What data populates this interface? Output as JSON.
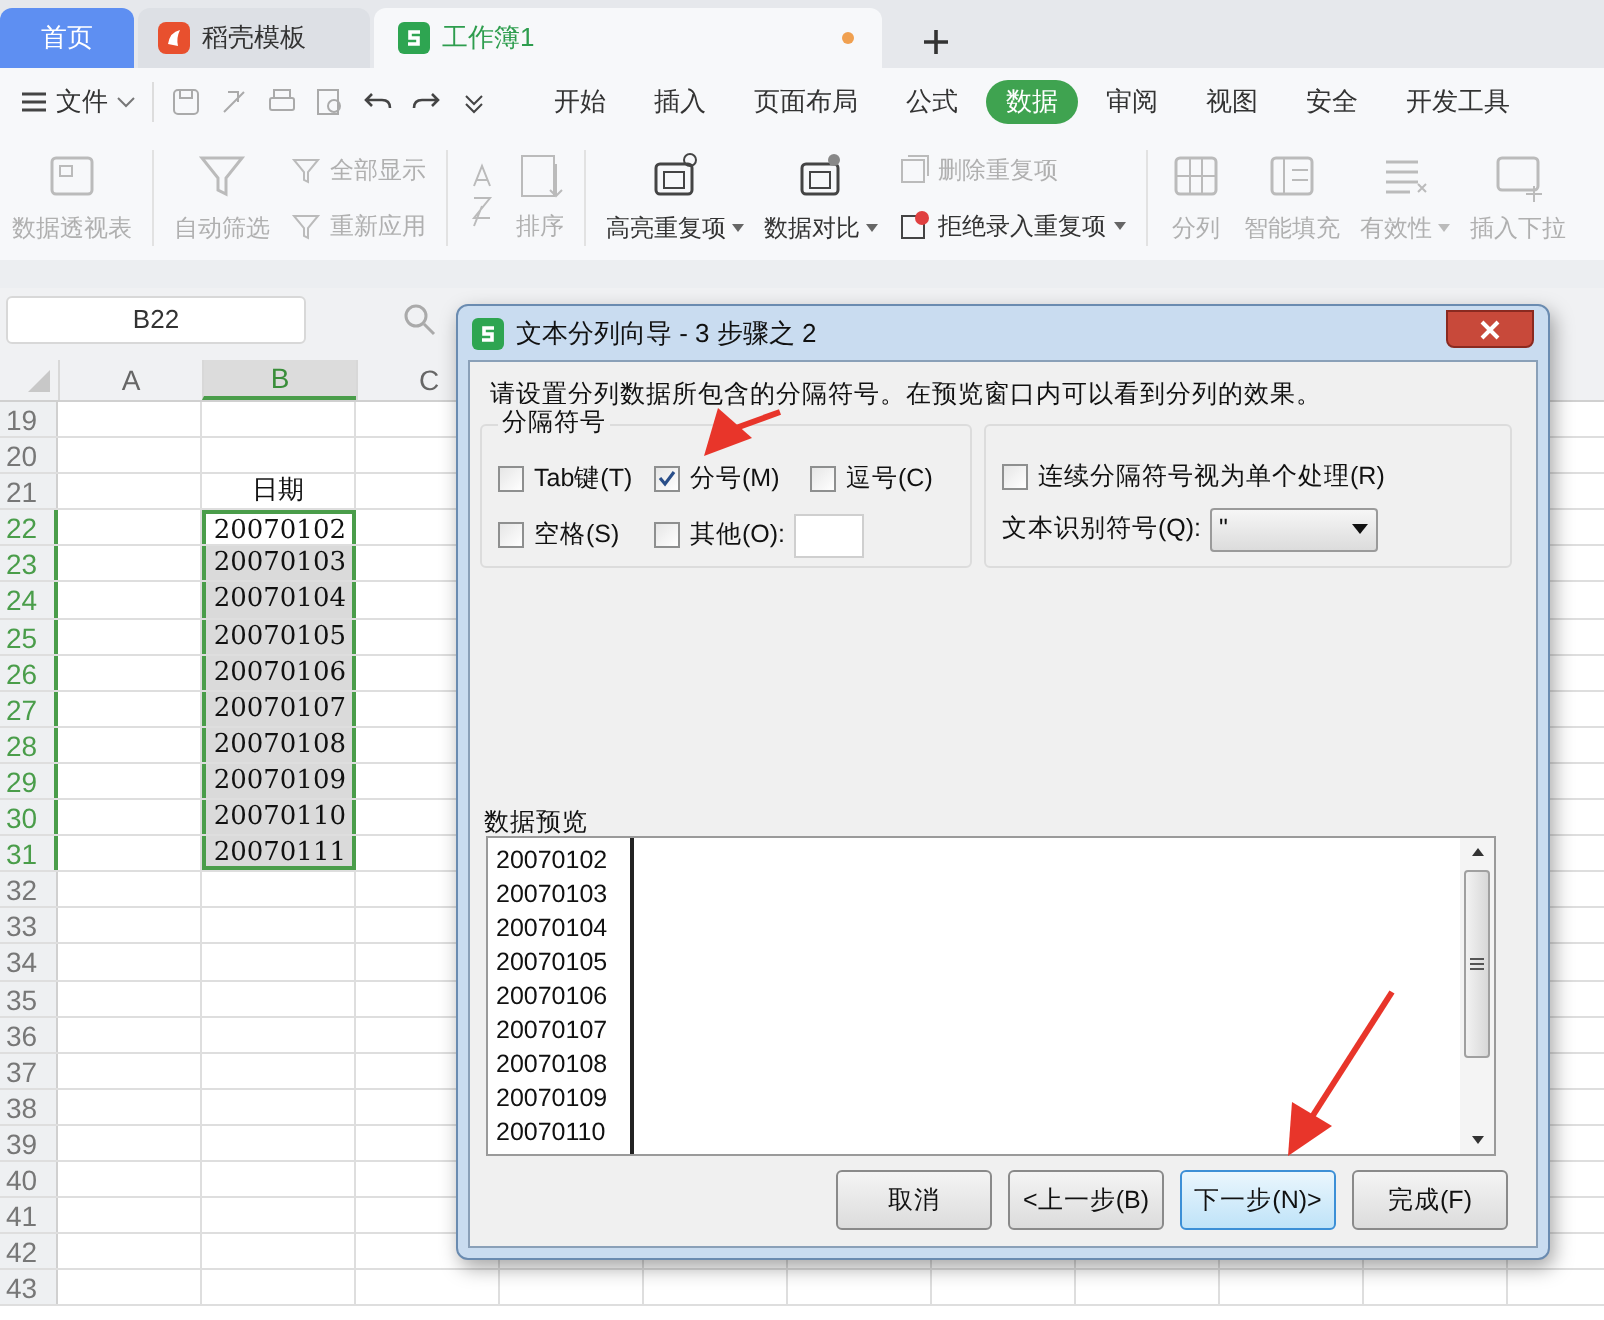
{
  "tabs": [
    {
      "label": "首页",
      "kind": "home",
      "selected": false
    },
    {
      "label": "稻壳模板",
      "kind": "docer",
      "selected": false
    },
    {
      "label": "工作簿1",
      "kind": "sheet",
      "selected": true,
      "unsaved": true
    }
  ],
  "menu": {
    "file": "文件",
    "items": [
      {
        "label": "开始",
        "selected": false
      },
      {
        "label": "插入",
        "selected": false
      },
      {
        "label": "页面布局",
        "selected": false
      },
      {
        "label": "公式",
        "selected": false
      },
      {
        "label": "数据",
        "selected": true
      },
      {
        "label": "审阅",
        "selected": false
      },
      {
        "label": "视图",
        "selected": false
      },
      {
        "label": "安全",
        "selected": false
      },
      {
        "label": "开发工具",
        "selected": false
      }
    ]
  },
  "toolbar": [
    {
      "kind": "big",
      "label": "数据透视表",
      "disabled": true,
      "dropdown": false
    },
    {
      "kind": "big",
      "label": "自动筛选",
      "disabled": true,
      "dropdown": false
    },
    {
      "kind": "pair",
      "items": [
        {
          "label": "全部显示",
          "disabled": true,
          "dropdown": false
        },
        {
          "label": "重新应用",
          "disabled": true,
          "dropdown": false
        }
      ]
    },
    {
      "kind": "sort",
      "label": "排序",
      "disabled": true,
      "dropdown": false
    },
    {
      "kind": "big",
      "label": "高亮重复项",
      "disabled": false,
      "dropdown": true
    },
    {
      "kind": "big",
      "label": "数据对比",
      "disabled": false,
      "dropdown": true
    },
    {
      "kind": "pair",
      "items": [
        {
          "label": "删除重复项",
          "disabled": true,
          "dropdown": false
        },
        {
          "label": "拒绝录入重复项",
          "disabled": false,
          "dropdown": true
        }
      ]
    },
    {
      "kind": "big",
      "label": "分列",
      "disabled": true,
      "dropdown": false
    },
    {
      "kind": "big",
      "label": "智能填充",
      "disabled": true,
      "dropdown": false
    },
    {
      "kind": "big",
      "label": "有效性",
      "disabled": true,
      "dropdown": true
    },
    {
      "kind": "big",
      "label": "插入下拉",
      "disabled": true,
      "dropdown": false
    }
  ],
  "name_box": "B22",
  "sheet": {
    "columns": [
      {
        "label": "A",
        "selected": false
      },
      {
        "label": "B",
        "selected": true
      },
      {
        "label": "C",
        "selected": false
      }
    ],
    "rows": [
      {
        "number": "19",
        "selected": false,
        "b": ""
      },
      {
        "number": "20",
        "selected": false,
        "b": ""
      },
      {
        "number": "21",
        "selected": false,
        "b": "日期"
      },
      {
        "number": "22",
        "selected": true,
        "active": true,
        "b": "20070102"
      },
      {
        "number": "23",
        "selected": true,
        "b": "20070103"
      },
      {
        "number": "24",
        "selected": true,
        "b": "20070104"
      },
      {
        "number": "25",
        "selected": true,
        "b": "20070105"
      },
      {
        "number": "26",
        "selected": true,
        "b": "20070106"
      },
      {
        "number": "27",
        "selected": true,
        "b": "20070107"
      },
      {
        "number": "28",
        "selected": true,
        "b": "20070108"
      },
      {
        "number": "29",
        "selected": true,
        "b": "20070109"
      },
      {
        "number": "30",
        "selected": true,
        "b": "20070110"
      },
      {
        "number": "31",
        "selected": true,
        "b": "20070111"
      },
      {
        "number": "32",
        "selected": false,
        "b": ""
      },
      {
        "number": "33",
        "selected": false,
        "b": ""
      },
      {
        "number": "34",
        "selected": false,
        "b": ""
      },
      {
        "number": "35",
        "selected": false,
        "b": ""
      },
      {
        "number": "36",
        "selected": false,
        "b": ""
      },
      {
        "number": "37",
        "selected": false,
        "b": ""
      },
      {
        "number": "38",
        "selected": false,
        "b": ""
      },
      {
        "number": "39",
        "selected": false,
        "b": ""
      },
      {
        "number": "40",
        "selected": false,
        "b": ""
      },
      {
        "number": "41",
        "selected": false,
        "b": ""
      },
      {
        "number": "42",
        "selected": false,
        "b": ""
      },
      {
        "number": "43",
        "selected": false,
        "b": ""
      }
    ]
  },
  "dialog": {
    "title": "文本分列向导 - 3 步骤之 2",
    "instruction": "请设置分列数据所包含的分隔符号。在预览窗口内可以看到分列的效果。",
    "delimiters_label": "分隔符号",
    "delimiters": [
      {
        "label": "Tab键(T)",
        "checked": false
      },
      {
        "label": "分号(M)",
        "checked": true
      },
      {
        "label": "逗号(C)",
        "checked": false
      },
      {
        "label": "空格(S)",
        "checked": false
      },
      {
        "label": "其他(O):",
        "checked": false,
        "kind": "other"
      }
    ],
    "consecutive": {
      "label": "连续分隔符号视为单个处理(R)",
      "checked": false
    },
    "qualifier": {
      "label": "文本识别符号(Q):",
      "value": "\""
    },
    "preview_label": "数据预览",
    "preview_lines": [
      "20070102",
      "20070103",
      "20070104",
      "20070105",
      "20070106",
      "20070107",
      "20070108",
      "20070109",
      "20070110"
    ],
    "buttons": [
      {
        "label": "取消",
        "default": false
      },
      {
        "label": "<上一步(B)",
        "default": false
      },
      {
        "label": "下一步(N)>",
        "default": true
      },
      {
        "label": "完成(F)",
        "default": false
      }
    ]
  }
}
